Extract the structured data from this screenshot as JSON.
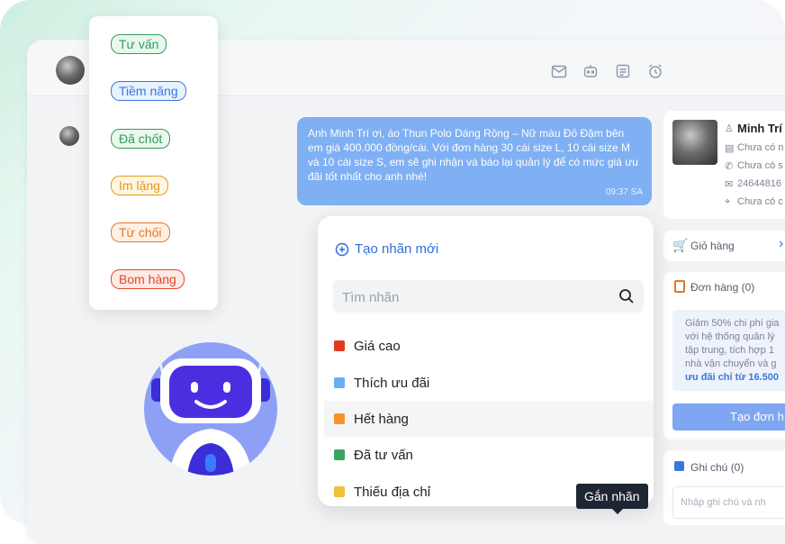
{
  "labels_menu": {
    "items": [
      {
        "label": "Tư vấn",
        "color": "#2f9e5b",
        "bg": "#eaf7ef"
      },
      {
        "label": "Tiềm năng",
        "color": "#3a78d8",
        "bg": "#e8f1ff"
      },
      {
        "label": "Đã chốt",
        "color": "#2f9e5b",
        "bg": "#eaf7ef"
      },
      {
        "label": "Im lặng",
        "color": "#e29a1b",
        "bg": "#fff6e3"
      },
      {
        "label": "Từ chối",
        "color": "#e0792d",
        "bg": "#fff0e4"
      },
      {
        "label": "Bom hàng",
        "color": "#e0492d",
        "bg": "#ffe9e4"
      }
    ]
  },
  "chat": {
    "message": "Anh Minh Trí ơi, áo Thun Polo Dáng Rộng – Nữ màu Đỏ Đậm bên em giá 400.000 đồng/cái. Với đơn hàng 30 cái size L, 10 cái size M và 10 cái size S, em sẽ ghi nhận và báo lại quản lý để có mức giá ưu đãi tốt nhất cho anh nhé!",
    "time": "09:37 SA"
  },
  "customer": {
    "name": "Minh Trí",
    "line1": "Chưa có n",
    "line2": "Chưa có s",
    "phone": "24644816",
    "address": "Chưa có c"
  },
  "cart": {
    "title": "Giỏ hàng",
    "arrow": "›"
  },
  "orders": {
    "title": "Đơn hàng (0)",
    "promo_lines": [
      "Giảm 50% chi phí gia",
      "với hệ thống quản lý",
      "tập trung, tích hợp 1",
      "nhà vận chuyển và g"
    ],
    "promo_link": "ưu đãi chỉ từ 16.500",
    "button": "Tạo đơn h"
  },
  "notes": {
    "title": "Ghi chú (0)",
    "placeholder": "Nhập ghi chú và nh"
  },
  "picker": {
    "create_label": "Tạo nhãn mới",
    "search_placeholder": "Tìm nhãn",
    "options": [
      {
        "label": "Giá cao",
        "color": "#e03a1e"
      },
      {
        "label": "Thích ưu đãi",
        "color": "#6aaef5"
      },
      {
        "label": "Hết hàng",
        "color": "#f7922a"
      },
      {
        "label": "Đã tư vấn",
        "color": "#3aa463"
      },
      {
        "label": "Thiếu địa chỉ",
        "color": "#f0c03a"
      }
    ]
  },
  "tooltip": "Gắn nhãn",
  "icons": {
    "toolbar": [
      "mail-icon",
      "bot-icon",
      "note-icon",
      "alarm-icon"
    ]
  }
}
